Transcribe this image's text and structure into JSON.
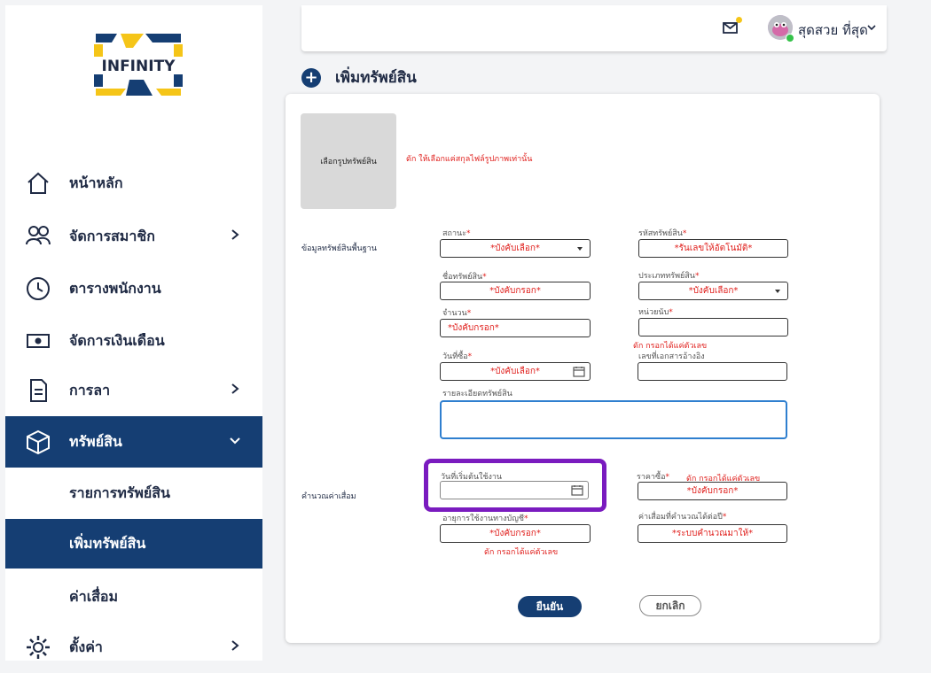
{
  "brand": {
    "logo_text": "INFINITY"
  },
  "sidebar": {
    "items": [
      {
        "label": "หน้าหลัก",
        "icon": "home-icon"
      },
      {
        "label": "จัดการสมาชิก",
        "icon": "users-icon"
      },
      {
        "label": "ตารางพนักงาน",
        "icon": "clock-icon"
      },
      {
        "label": "จัดการเงินเดือน",
        "icon": "money-icon"
      },
      {
        "label": "การลา",
        "icon": "document-icon"
      },
      {
        "label": "ทรัพย์สิน",
        "icon": "box-icon"
      },
      {
        "label": "ตั้งค่า",
        "icon": "gear-icon"
      }
    ],
    "sub_items": [
      {
        "label": "รายการทรัพย์สิน"
      },
      {
        "label": "เพิ่มทรัพย์สิน"
      },
      {
        "label": "ค่าเสื่อม"
      }
    ]
  },
  "header": {
    "user_name": "สุดสวย ที่สุด"
  },
  "page": {
    "title": "เพิ่มทรัพย์สิน"
  },
  "form": {
    "image_button": "เลือกรูปทรัพย์สิน",
    "image_hint": "ดัก ให้เลือกแค่สกุลไฟล์รูปภาพเท่านั้น",
    "section_basic": "ข้อมูลทรัพย์สินพื้นฐาน",
    "section_depreciation": "คำนวณค่าเสื่อม",
    "status": {
      "label": "สถานะ",
      "value": "*บังคับเลือก*"
    },
    "asset_code": {
      "label": "รหัสทรัพย์สิน",
      "value": "*รันเลขให้อัตโนมัติ*"
    },
    "asset_name": {
      "label": "ชื่อทรัพย์สิน",
      "value": "*บังคับกรอก*"
    },
    "asset_type": {
      "label": "ประเภททรัพย์สิน",
      "value": "*บังคับเลือก*"
    },
    "quantity": {
      "label": "จำนวน",
      "value": "*บังคับกรอก*"
    },
    "unit": {
      "label": "หน่วยนับ",
      "value": ""
    },
    "unit_error": "ดัก กรอกได้แค่ตัวเลข",
    "purchase_date": {
      "label": "วันที่ซื้อ",
      "value": "*บังคับเลือก*"
    },
    "reference_doc": {
      "label": "เลขที่เอกสารอ้างอิง",
      "value": ""
    },
    "description": {
      "label": "รายละเอียดทรัพย์สิน",
      "value": ""
    },
    "start_date": {
      "label": "วันที่เริ่มต้นใช้งาน",
      "value": ""
    },
    "price": {
      "label": "ราคาซื้อ",
      "value": "*บังคับกรอก*"
    },
    "price_error": "ดัก กรอกได้แค่ตัวเลข",
    "useful_life": {
      "label": "อายุการใช้งานทางบัญชี",
      "value": "*บังคับกรอก*"
    },
    "useful_life_error": "ดัก กรอกได้แค่ตัวเลข",
    "annual_depreciation": {
      "label": "ค่าเสื่อมที่คำนวณได้ต่อปี",
      "value": "*ระบบคำนวณมาให้*"
    },
    "required_mark": "*",
    "confirm_button": "ยืนยัน",
    "cancel_button": "ยกเลิก"
  },
  "colors": {
    "primary": "#153e73",
    "error": "#e0201d",
    "highlight": "#7a1bbf",
    "focus": "#2f7fcf"
  }
}
